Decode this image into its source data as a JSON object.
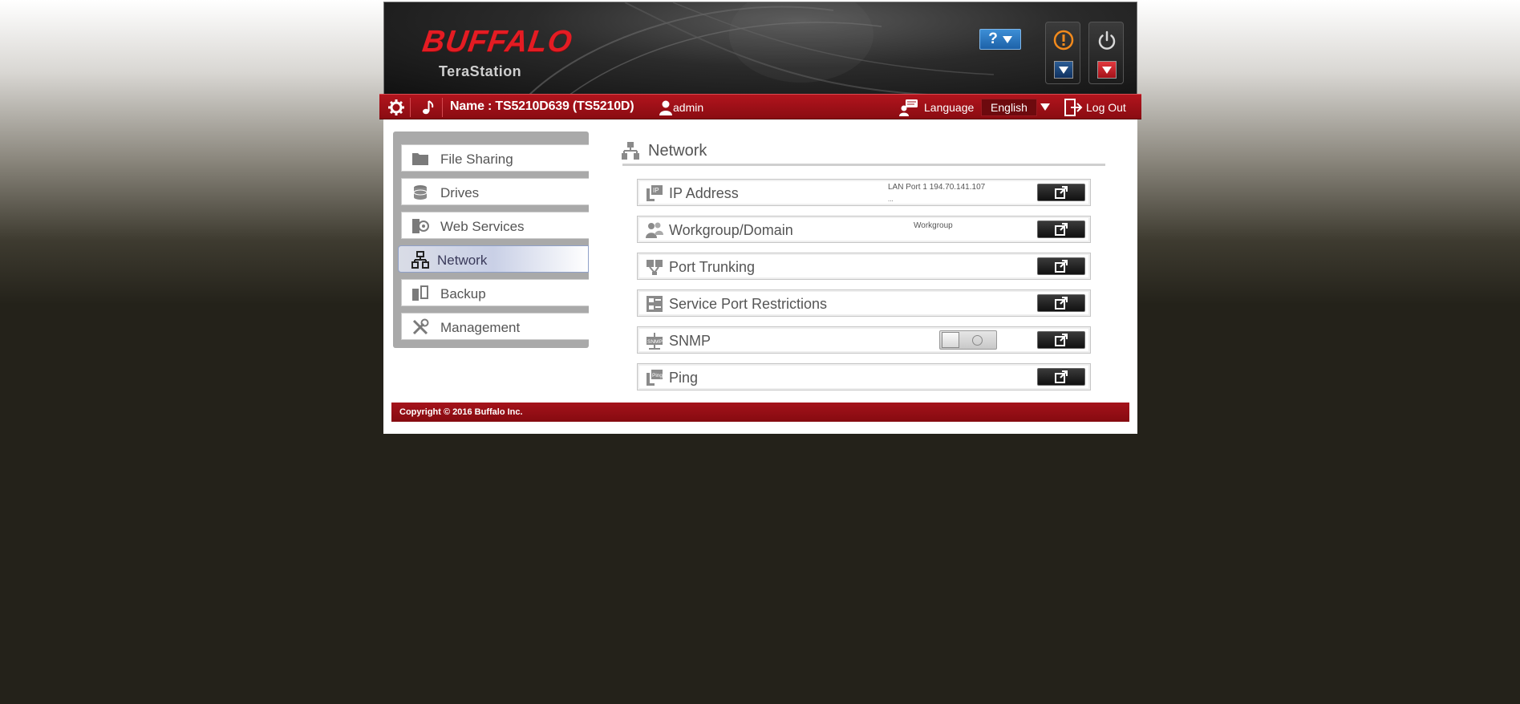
{
  "header": {
    "logo": "BUFFALO",
    "product": "TeraStation",
    "help_label": "?",
    "colors": {
      "brand_red": "#e41c23",
      "help_blue": "#1f68b3"
    }
  },
  "topbar": {
    "device_name": "Name : TS5210D639 (TS5210D)",
    "user": "admin",
    "language_label": "Language",
    "language_value": "English",
    "logout_label": "Log Out"
  },
  "sidebar": {
    "items": [
      {
        "label": "File Sharing",
        "icon": "folder-icon"
      },
      {
        "label": "Drives",
        "icon": "drive-icon"
      },
      {
        "label": "Web Services",
        "icon": "web-services-icon"
      },
      {
        "label": "Network",
        "icon": "network-icon",
        "active": true
      },
      {
        "label": "Backup",
        "icon": "backup-icon"
      },
      {
        "label": "Management",
        "icon": "tools-icon"
      }
    ]
  },
  "main": {
    "title": "Network",
    "rows": [
      {
        "label": "IP Address",
        "info": "LAN Port 1 194.70.141.107",
        "info2": "...",
        "icon": "ip-icon"
      },
      {
        "label": "Workgroup/Domain",
        "info": "Workgroup",
        "icon": "users-icon"
      },
      {
        "label": "Port Trunking",
        "icon": "port-trunking-icon"
      },
      {
        "label": "Service Port Restrictions",
        "icon": "restrictions-icon"
      },
      {
        "label": "SNMP",
        "icon": "snmp-icon",
        "toggle": "off"
      },
      {
        "label": "Ping",
        "icon": "ping-icon"
      }
    ]
  },
  "footer": {
    "copyright": "Copyright © 2016 Buffalo Inc."
  }
}
